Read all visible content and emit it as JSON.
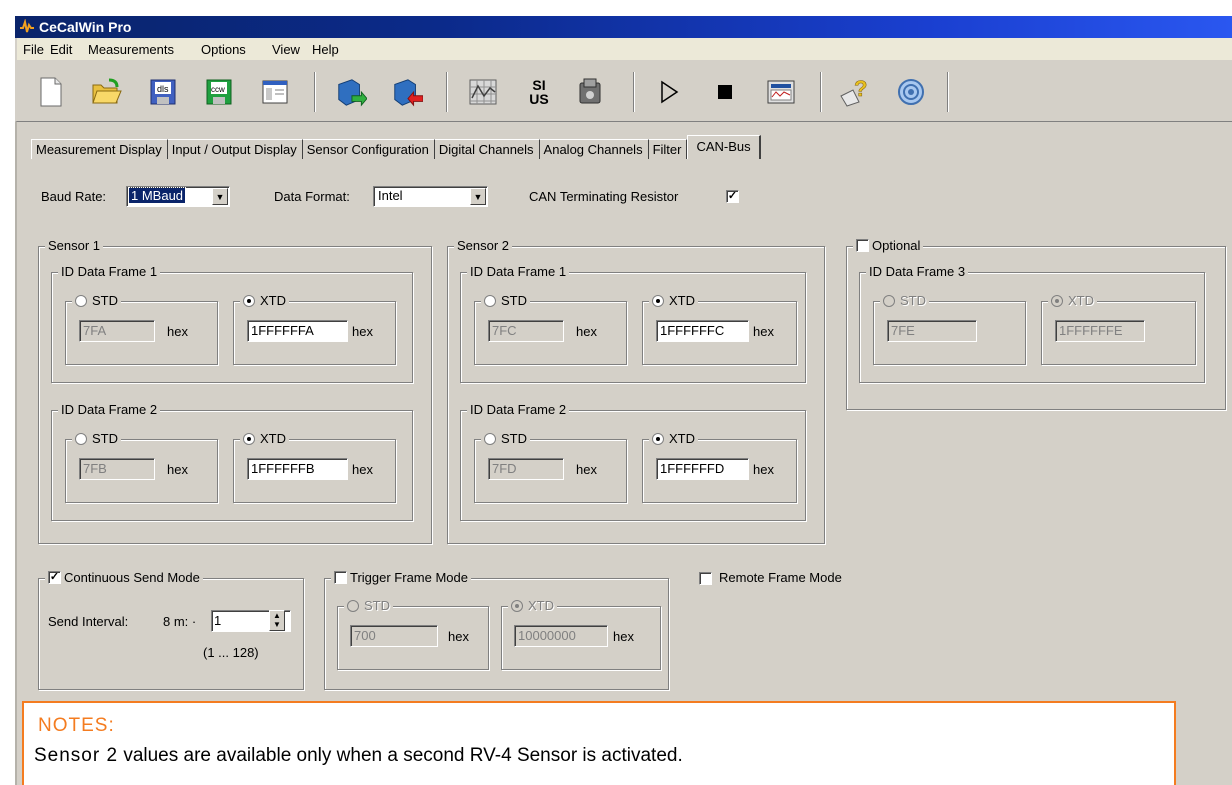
{
  "window": {
    "title": "CeCalWin Pro"
  },
  "menu": [
    "File",
    "Edit",
    "Measurements",
    "Options",
    "View",
    "Help"
  ],
  "toolbar": {
    "icons": [
      "new-file-icon",
      "open-folder-icon",
      "save-dls-icon",
      "save-ccw-icon",
      "layout-icon",
      "import-icon",
      "export-icon",
      "grid-chart-icon",
      "si-us-units-icon",
      "sensor-device-icon",
      "play-icon",
      "stop-icon",
      "recorder-icon",
      "help-icon",
      "about-icon"
    ],
    "dls_text": "dls",
    "ccw_text": "ccw",
    "si_text": "SI",
    "us_text": "US"
  },
  "tabs": [
    "Measurement Display",
    "Input / Output Display",
    "Sensor Configuration",
    "Digital Channels",
    "Analog Channels",
    "Filter",
    "CAN-Bus"
  ],
  "active_tab": "CAN-Bus",
  "baud": {
    "label": "Baud Rate:",
    "value": "1 MBaud"
  },
  "format": {
    "label": "Data Format:",
    "value": "Intel"
  },
  "terminating": {
    "label": "CAN Terminating Resistor",
    "checked": "✓"
  },
  "sensor1": {
    "title": "Sensor 1",
    "frame1": {
      "title": "ID Data Frame 1",
      "std_label": "STD",
      "xtd_label": "XTD",
      "std_value": "7FA",
      "xtd_value": "1FFFFFFA"
    },
    "frame2": {
      "title": "ID Data Frame 2",
      "std_label": "STD",
      "xtd_label": "XTD",
      "std_value": "7FB",
      "xtd_value": "1FFFFFFB"
    }
  },
  "sensor2": {
    "title": "Sensor 2",
    "frame1": {
      "title": "ID Data Frame 1",
      "std_label": "STD",
      "xtd_label": "XTD",
      "std_value": "7FC",
      "xtd_value": "1FFFFFFC"
    },
    "frame2": {
      "title": "ID Data Frame 2",
      "std_label": "STD",
      "xtd_label": "XTD",
      "std_value": "7FD",
      "xtd_value": "1FFFFFFD"
    }
  },
  "optional": {
    "label": "Optional",
    "frame3": {
      "title": "ID Data Frame 3",
      "std_label": "STD",
      "xtd_label": "XTD",
      "std_value": "7FE",
      "xtd_value": "1FFFFFFE"
    }
  },
  "hex": "hex",
  "continuous": {
    "label": "Continuous Send Mode",
    "checked": "✓",
    "interval_label": "Send Interval:",
    "unit": "8 m: ·",
    "value": "1",
    "range": "(1 ... 128)"
  },
  "trigger": {
    "label": "Trigger Frame Mode",
    "std_label": "STD",
    "xtd_label": "XTD",
    "std_value": "700",
    "xtd_value": "10000000"
  },
  "remote": {
    "label": "Remote Frame Mode"
  },
  "notes": {
    "title": "NOTES:",
    "lead": "Sensor 2",
    "body": " values are available only when a second RV-4 Sensor is activated."
  }
}
